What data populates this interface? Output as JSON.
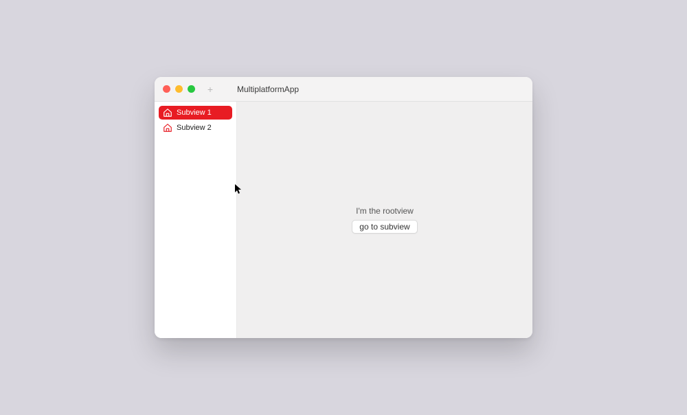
{
  "window": {
    "title": "MultiplatformApp",
    "add_label": "+"
  },
  "sidebar": {
    "items": [
      {
        "label": "Subview 1",
        "selected": true
      },
      {
        "label": "Subview 2",
        "selected": false
      }
    ]
  },
  "content": {
    "root_text": "I'm the rootview",
    "button_label": "go to subview"
  },
  "colors": {
    "accent": "#e81c23"
  }
}
